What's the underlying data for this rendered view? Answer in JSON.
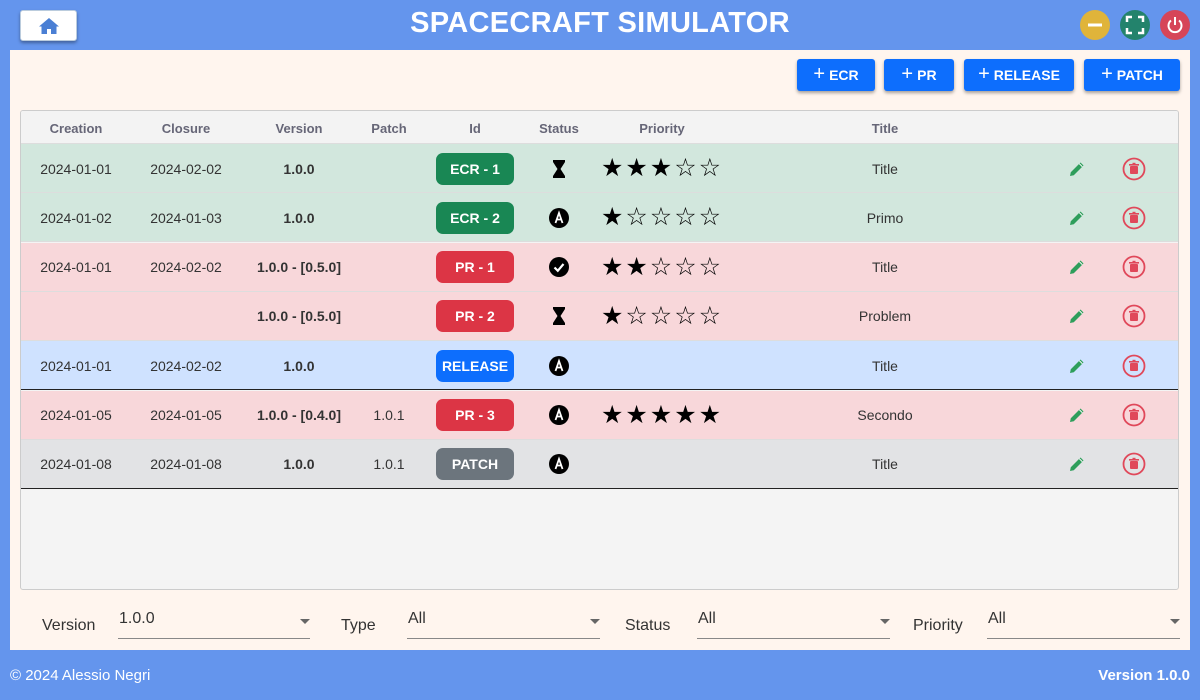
{
  "window": {
    "title": "SPACECRAFT SIMULATOR"
  },
  "toolbar": {
    "buttons": [
      {
        "label": "ECR"
      },
      {
        "label": "PR"
      },
      {
        "label": "RELEASE"
      },
      {
        "label": "PATCH"
      }
    ]
  },
  "table": {
    "headers": [
      "Creation",
      "Closure",
      "Version",
      "Patch",
      "Id",
      "Status",
      "Priority",
      "Title"
    ],
    "rows": [
      {
        "creation": "2024-01-01",
        "closure": "2024-02-02",
        "version": "1.0.0",
        "patch": "",
        "id": "ECR - 1",
        "type": "ecr",
        "status": "in-progress",
        "priority": 3,
        "title": "Title"
      },
      {
        "creation": "2024-01-02",
        "closure": "2024-01-03",
        "version": "1.0.0",
        "patch": "",
        "id": "ECR - 2",
        "type": "ecr",
        "status": "approved",
        "priority": 1,
        "title": "Primo"
      },
      {
        "creation": "2024-01-01",
        "closure": "2024-02-02",
        "version": "1.0.0 - [0.5.0]",
        "patch": "",
        "id": "PR - 1",
        "type": "pr",
        "status": "done",
        "priority": 2,
        "title": "Title"
      },
      {
        "creation": "",
        "closure": "",
        "version": "1.0.0 - [0.5.0]",
        "patch": "",
        "id": "PR - 2",
        "type": "pr",
        "status": "in-progress",
        "priority": 1,
        "title": "Problem"
      },
      {
        "creation": "2024-01-01",
        "closure": "2024-02-02",
        "version": "1.0.0",
        "patch": "",
        "id": "RELEASE",
        "type": "release",
        "status": "approved",
        "priority": null,
        "title": "Title"
      },
      {
        "creation": "2024-01-05",
        "closure": "2024-01-05",
        "version": "1.0.0 - [0.4.0]",
        "patch": "1.0.1",
        "id": "PR - 3",
        "type": "pr",
        "status": "approved",
        "priority": 5,
        "title": "Secondo"
      },
      {
        "creation": "2024-01-08",
        "closure": "2024-01-08",
        "version": "1.0.0",
        "patch": "1.0.1",
        "id": "PATCH",
        "type": "patch",
        "status": "approved",
        "priority": null,
        "title": "Title"
      }
    ]
  },
  "filters": [
    {
      "label": "Version",
      "value": "1.0.0"
    },
    {
      "label": "Type",
      "value": "All"
    },
    {
      "label": "Status",
      "value": "All"
    },
    {
      "label": "Priority",
      "value": "All"
    }
  ],
  "footer": {
    "left": "© 2024 Alessio Negri",
    "right": "Version 1.0.0"
  },
  "colors": {
    "header_bg": "#6495ED",
    "panel_bg": "#FFF5EE",
    "primary": "#0D6EFD",
    "ecr": "#198754",
    "pr": "#DC3545",
    "release": "#0D6EFD",
    "patch": "#6C757D",
    "edit": "#2E9E5B",
    "delete": "#E0485A"
  },
  "icons": {
    "home": "home-icon",
    "minimize": "minimize-icon",
    "maximize": "fullscreen-icon",
    "close": "power-icon",
    "status_in_progress": "hourglass-icon",
    "status_approved": "circle-a-icon",
    "status_done": "check-circle-icon",
    "edit": "pencil-icon",
    "delete": "trash-icon"
  }
}
